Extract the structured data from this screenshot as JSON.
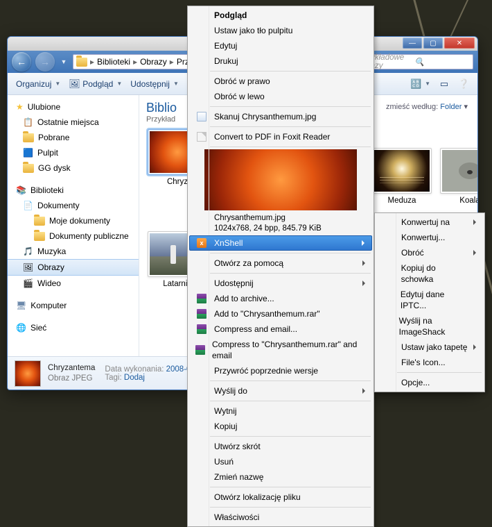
{
  "breadcrumbs": [
    "Biblioteki",
    "Obrazy",
    "Przykładow"
  ],
  "search": {
    "placeholder": "Przykładowe obrazy"
  },
  "toolbar": {
    "organize": "Organizuj",
    "preview": "Podgląd",
    "share": "Udostępnij"
  },
  "sidebar": {
    "favorites": {
      "title": "Ulubione",
      "items": [
        "Ostatnie miejsca",
        "Pobrane",
        "Pulpit",
        "GG dysk"
      ]
    },
    "libraries": {
      "title": "Biblioteki",
      "items": [
        {
          "label": "Dokumenty",
          "children": [
            "Moje dokumenty",
            "Dokumenty publiczne"
          ]
        },
        {
          "label": "Muzyka"
        },
        {
          "label": "Obrazy",
          "selected": true
        },
        {
          "label": "Wideo"
        }
      ]
    },
    "computer": "Komputer",
    "network": "Sieć"
  },
  "library": {
    "title": "Biblio",
    "subtitle": "Przykład",
    "arrange_label": "zmieść według:",
    "arrange_value": "Folder"
  },
  "thumbs": [
    {
      "label": "Chryz",
      "kind": "chrys",
      "selected": true
    },
    {
      "label": "Latarnia",
      "kind": "lighthouse"
    },
    {
      "label": "Meduza",
      "kind": "jellyfish"
    },
    {
      "label": "Koala",
      "kind": "koala"
    }
  ],
  "details": {
    "title": "Chryzantema",
    "type": "Obraz JPEG",
    "date_label": "Data wykonania:",
    "date_value": "2008-0",
    "tags_label": "Tagi:",
    "tags_value": "Dodaj"
  },
  "ctx_main": {
    "podglad": "Podgląd",
    "ustaw_tlo": "Ustaw jako tło pulpitu",
    "edytuj": "Edytuj",
    "drukuj": "Drukuj",
    "obroc_prawo": "Obróć w prawo",
    "obroc_lewo": "Obróć w lewo",
    "skanuj": "Skanuj Chrysanthemum.jpg",
    "pdf": "Convert to PDF in Foxit Reader",
    "preview_name": "Chrysanthemum.jpg",
    "preview_meta": "1024x768, 24 bpp, 845.79 KiB",
    "xnshell": "XnShell",
    "otworz_za": "Otwórz za pomocą",
    "udostepnij": "Udostępnij",
    "add_archive": "Add to archive...",
    "add_rar": "Add to \"Chrysanthemum.rar\"",
    "compress_email": "Compress and email...",
    "compress_rar_email": "Compress to \"Chrysanthemum.rar\" and email",
    "przywroc": "Przywróć poprzednie wersje",
    "wyslij_do": "Wyślij do",
    "wytnij": "Wytnij",
    "kopiuj": "Kopiuj",
    "skrot": "Utwórz skrót",
    "usun": "Usuń",
    "zmien": "Zmień nazwę",
    "lokalizacja": "Otwórz lokalizację pliku",
    "wlasciwosci": "Właściwości"
  },
  "ctx_sub": {
    "konwertuj_na": "Konwertuj na",
    "konwertuj": "Konwertuj...",
    "obroc": "Obróć",
    "kopiuj_schowek": "Kopiuj do schowka",
    "edytuj_iptc": "Edytuj dane IPTC...",
    "imageshack": "Wyślij na ImageShack",
    "tapeta": "Ustaw jako tapetę",
    "files_icon": "File's Icon...",
    "opcje": "Opcje..."
  }
}
